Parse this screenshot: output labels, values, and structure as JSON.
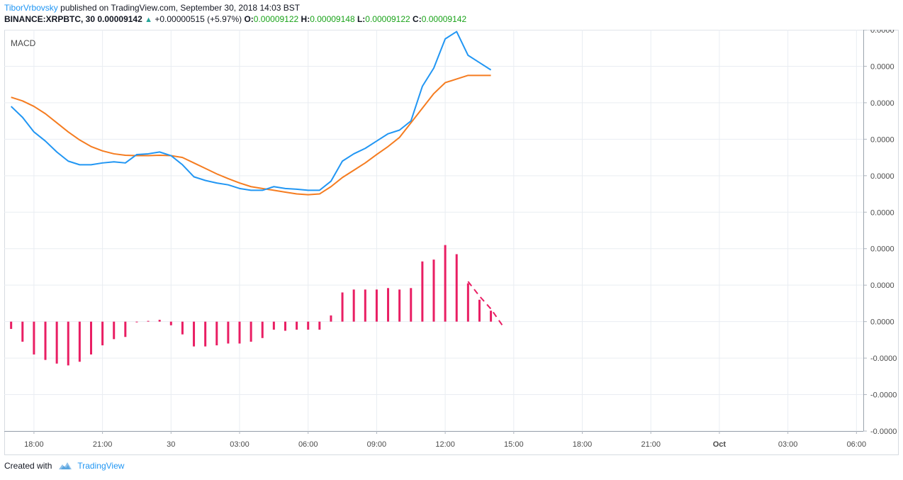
{
  "header": {
    "author": "TiborVrbovsky",
    "published_text": "published on TradingView.com, September 30, 2018 14:03 BST",
    "symbol": "BINANCE:XRPBTC, 30",
    "last": "0.00009142",
    "change": "+0.00000515 (+5.97%)",
    "o_label": "O:",
    "o_value": "0.00009122",
    "h_label": "H:",
    "h_value": "0.00009148",
    "l_label": "L:",
    "l_value": "0.00009122",
    "c_label": "C:",
    "c_value": "0.00009142",
    "up_icon": "triangle-up-icon"
  },
  "footer": {
    "created_with": "Created with",
    "brand": "TradingView",
    "logo_icon": "tradingview-cloud-icon"
  },
  "colors": {
    "macd_line": "#2196f3",
    "signal_line": "#f57c20",
    "histogram": "#e91e63",
    "grid": "#e9edf2",
    "axis_text": "#4a4a4a",
    "price_green": "#1aa31a"
  },
  "chart_data": {
    "type": "line",
    "title": "MACD",
    "xlabel": "",
    "ylabel": "",
    "grid": true,
    "time_labels": [
      "18:00",
      "21:00",
      "30",
      "03:00",
      "06:00",
      "09:00",
      "12:00",
      "15:00",
      "18:00",
      "21:00",
      "Oct",
      "03:00",
      "06:00"
    ],
    "y_tick_labels": [
      "0.0000",
      "0.0000",
      "0.0000",
      "0.0000",
      "0.0000",
      "0.0000",
      "0.0000",
      "0.0000",
      "0.0000",
      "-0.0000",
      "-0.0000",
      "-0.0000"
    ],
    "ylim": [
      -3,
      8
    ],
    "x_units": "hours from 18:00 Sep 29",
    "macd": {
      "name": "MACD",
      "x": [
        -1,
        -0.5,
        0,
        0.5,
        1,
        1.5,
        2,
        2.5,
        3,
        3.5,
        4,
        4.5,
        5,
        5.5,
        6,
        6.5,
        7,
        7.5,
        8,
        8.5,
        9,
        9.5,
        10,
        10.5,
        11,
        11.5,
        12,
        12.5,
        13,
        13.5,
        14,
        14.5,
        15,
        15.5,
        16,
        16.5,
        17,
        17.5,
        18,
        18.5,
        19,
        19.5,
        20
      ],
      "values": [
        5.9,
        5.6,
        5.2,
        4.95,
        4.65,
        4.4,
        4.3,
        4.3,
        4.35,
        4.38,
        4.35,
        4.58,
        4.6,
        4.65,
        4.55,
        4.3,
        3.97,
        3.87,
        3.8,
        3.75,
        3.65,
        3.6,
        3.6,
        3.7,
        3.65,
        3.63,
        3.6,
        3.6,
        3.85,
        4.4,
        4.6,
        4.75,
        4.95,
        5.15,
        5.25,
        5.5,
        6.45,
        6.95,
        7.75,
        7.95,
        7.3,
        7.1,
        6.9
      ]
    },
    "signal": {
      "name": "Signal",
      "x": [
        -1,
        -0.5,
        0,
        0.5,
        1,
        1.5,
        2,
        2.5,
        3,
        3.5,
        4,
        4.5,
        5,
        5.5,
        6,
        6.5,
        7,
        7.5,
        8,
        8.5,
        9,
        9.5,
        10,
        10.5,
        11,
        11.5,
        12,
        12.5,
        13,
        13.5,
        14,
        14.5,
        15,
        15.5,
        16,
        16.5,
        17,
        17.5,
        18,
        18.5,
        19,
        19.5,
        20
      ],
      "values": [
        6.15,
        6.05,
        5.9,
        5.7,
        5.45,
        5.2,
        4.98,
        4.8,
        4.68,
        4.6,
        4.56,
        4.55,
        4.55,
        4.56,
        4.55,
        4.5,
        4.35,
        4.2,
        4.05,
        3.92,
        3.8,
        3.7,
        3.65,
        3.6,
        3.55,
        3.5,
        3.48,
        3.5,
        3.7,
        3.95,
        4.15,
        4.35,
        4.58,
        4.8,
        5.05,
        5.45,
        5.85,
        6.25,
        6.55,
        6.65,
        6.75,
        6.75,
        6.75
      ]
    },
    "histogram": {
      "name": "Histogram",
      "x": [
        -1,
        -0.5,
        0,
        0.5,
        1,
        1.5,
        2,
        2.5,
        3,
        3.5,
        4,
        4.5,
        5,
        5.5,
        6,
        6.5,
        7,
        7.5,
        8,
        8.5,
        9,
        9.5,
        10,
        10.5,
        11,
        11.5,
        12,
        12.5,
        13,
        13.5,
        14,
        14.5,
        15,
        15.5,
        16,
        16.5,
        17,
        17.5,
        18,
        18.5,
        19,
        19.5,
        20
      ],
      "values": [
        -0.2,
        -0.55,
        -0.9,
        -1.05,
        -1.15,
        -1.2,
        -1.1,
        -0.9,
        -0.65,
        -0.48,
        -0.42,
        -0.02,
        0.02,
        0.05,
        -0.1,
        -0.35,
        -0.68,
        -0.68,
        -0.65,
        -0.6,
        -0.6,
        -0.55,
        -0.45,
        -0.22,
        -0.25,
        -0.22,
        -0.22,
        -0.22,
        0.17,
        0.8,
        0.88,
        0.88,
        0.88,
        0.92,
        0.88,
        0.92,
        1.65,
        1.7,
        2.1,
        1.85,
        1.05,
        0.6,
        0.3
      ]
    },
    "histogram_projection": {
      "x": [
        19,
        19.5,
        20,
        20.5
      ],
      "values": [
        1.1,
        0.7,
        0.35,
        -0.1
      ]
    }
  }
}
